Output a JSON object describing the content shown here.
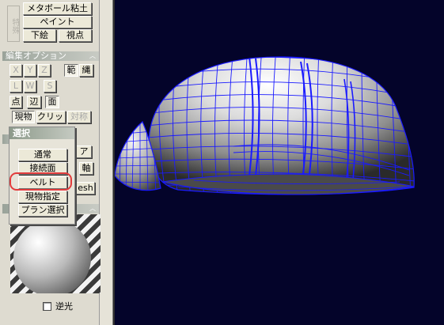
{
  "panel": {
    "vertical_group_label": "特殊",
    "top_buttons": {
      "metaball": "メタボール粘土",
      "paint": "ペイント",
      "underlay": "下絵",
      "viewpoint": "視点"
    },
    "edit_options": {
      "header": "編集オプション",
      "x": "X",
      "y": "Y",
      "z": "Z",
      "range": "範",
      "rope": "縄",
      "l": "L",
      "w": "W",
      "s": "S",
      "point": "点",
      "edge": "辺",
      "face": "面",
      "current_object": "現物",
      "grid": "クリッド",
      "symmetry": "対称"
    },
    "hidden_buttons": {
      "a": "ア",
      "axis": "軸",
      "mesh": "esh"
    }
  },
  "select_popup": {
    "title": "選択",
    "items": [
      "通常",
      "接続面",
      "ベルト",
      "現物指定",
      "プラン選択"
    ],
    "highlighted_index": 2
  },
  "material": {
    "backlight_label": "逆光",
    "backlight_checked": false
  },
  "colors": {
    "wire": "#1a1aff",
    "viewport_bg": "#04042a",
    "highlight_ring": "#e23c3c"
  }
}
